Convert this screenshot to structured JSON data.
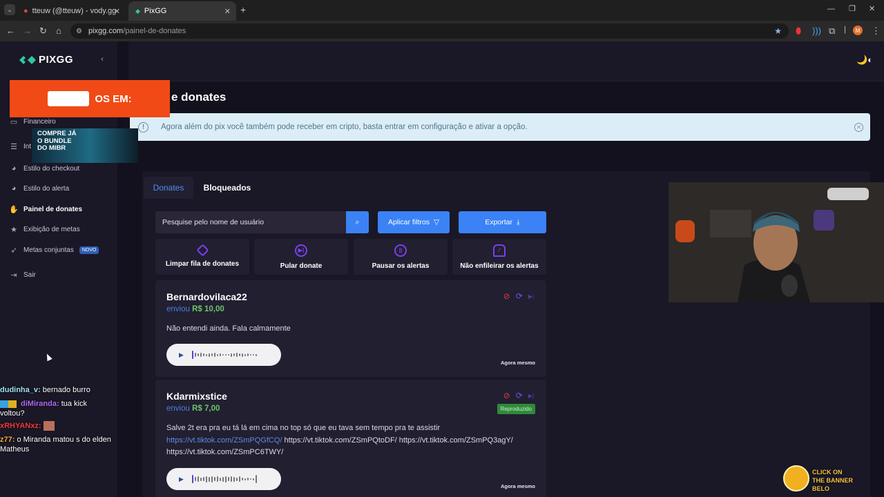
{
  "browser": {
    "tabs": [
      {
        "title": "tteuw (@tteuw) - vody.gg",
        "active": false
      },
      {
        "title": "PixGG",
        "active": true
      }
    ],
    "new_tab": "+",
    "url_domain": "pixgg.com",
    "url_path": "/painel-de-donates",
    "profile_initial": "M"
  },
  "sidebar": {
    "logo": "PIXGG",
    "items": [
      {
        "label": "Financeiro",
        "icon": "wallet-icon"
      },
      {
        "label": "Int",
        "icon": "list-icon"
      },
      {
        "label": "Estilo do checkout",
        "icon": "palette-icon"
      },
      {
        "label": "Estilo do alerta",
        "icon": "palette-icon"
      },
      {
        "label": "Painel de donates",
        "icon": "donate-icon",
        "active": true
      },
      {
        "label": "Exibição de metas",
        "icon": "star-icon"
      },
      {
        "label": "Metas conjuntas",
        "icon": "rocket-icon",
        "badge": "NOVO"
      },
      {
        "label": "Sair",
        "icon": "logout-icon"
      }
    ]
  },
  "page": {
    "title_fragment": "e donates",
    "info_text": "Agora além do pix você também pode receber em cripto, basta entrar em configuração e ativar a opção.",
    "tabs": [
      "Donates",
      "Bloqueados"
    ],
    "search_placeholder": "Pesquise pelo nome de usuário",
    "apply_filters": "Aplicar filtros",
    "export": "Exportar",
    "actions": [
      {
        "label": "Limpar fila de donates",
        "icon": "eraser-icon"
      },
      {
        "label": "Pular donate",
        "icon": "skip-icon"
      },
      {
        "label": "Pausar os alertas",
        "icon": "pause-icon"
      },
      {
        "label": "Não enfileirar os alertas",
        "icon": "bell-off-icon"
      }
    ],
    "donates": [
      {
        "name": "Bernardovilaca22",
        "sent_label": "enviou",
        "amount": "R$ 10,00",
        "message": "Não entendi ainda. Fala calmamente",
        "time": "Agora mesmo"
      },
      {
        "name": "Kdarmixstice",
        "sent_label": "enviou",
        "amount": "R$ 7,00",
        "message_lead": "Salve 2t era pra eu tá lá em cima no top só que eu tava sem tempo pra te assistir",
        "link1": "https://vt.tiktok.com/ZSmPQGfCQ/",
        "links_rest": "https://vt.tiktok.com/ZSmPQtoDF/ https://vt.tiktok.com/ZSmPQ3agY/",
        "link_last": "https://vt.tiktok.com/ZSmPC6TWY/",
        "status": "Reproduzido",
        "time": "Agora mesmo"
      }
    ]
  },
  "overlays": {
    "banner_text": "OS EM:",
    "mibr_text": "COMPRE JÁ O BUNDLE DO MIBR",
    "click_text": "CLICK ON THE BANNER BELO"
  },
  "chat": [
    {
      "name": "dudinha_v:",
      "msg": "bernado burro"
    },
    {
      "name": "diMiranda:",
      "msg": "tua kick voltou?"
    },
    {
      "name": "xRHYANxz:",
      "msg": ""
    },
    {
      "name": "z77:",
      "msg": "o Miranda matou s do elden Matheus"
    }
  ],
  "colors": {
    "accent": "#3b82f6",
    "purple": "#7a4cf2",
    "green": "#6cc56a",
    "red": "#e03a3a"
  }
}
